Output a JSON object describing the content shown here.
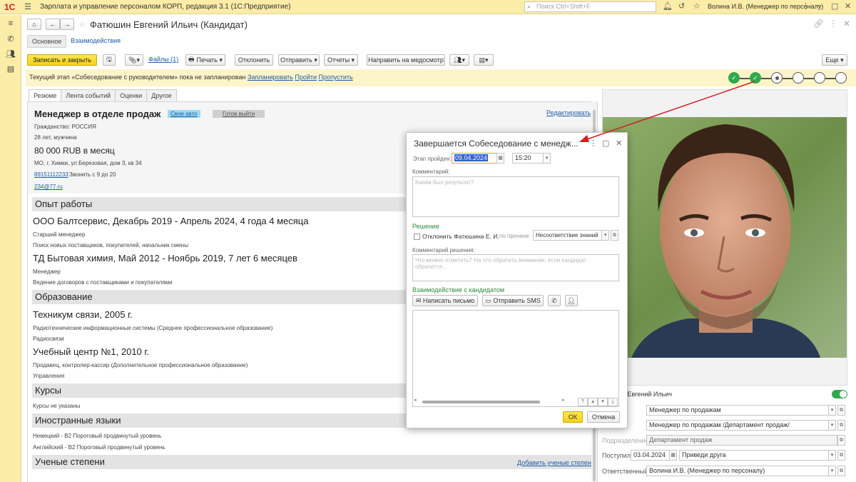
{
  "app": {
    "logo": "1С",
    "title": "Зарплата и управление персоналом КОРП, редакция 3.1  (1С:Предприятие)",
    "search_placeholder": "Поиск Ctrl+Shift+F",
    "user": "Волина И.В. (Менеджер по персоналу)"
  },
  "document": {
    "title": "Фатюшин Евгений Ильич (Кандидат)",
    "tabs": [
      "Основное",
      "Взаимодействия"
    ]
  },
  "toolbar": {
    "save_close": "Записать и закрыть",
    "files": "Файлы (1)",
    "print": "Печать",
    "reject": "Отклонить",
    "send": "Отправить",
    "reports": "Отчеты",
    "medical": "Направить на медосмотр",
    "more": "Еще"
  },
  "stage": {
    "text": "Текущий этап «Собеседование с руководителем» пока не запланирован",
    "plan": "Запланировать",
    "pass": "Пройти",
    "skip": "Пропустить",
    "nodes": [
      "done",
      "done",
      "current",
      "pending",
      "pending",
      "pending"
    ]
  },
  "panel_tabs": [
    "Резюме",
    "Лента событий",
    "Оценки",
    "Другое"
  ],
  "resume": {
    "position": "Менеджер в отделе продаж",
    "badge_car": "Свое авто",
    "badge_ready": "Готов выйти",
    "edit": "Редактировать",
    "citizenship": "Гражданство: РОССИЯ",
    "age": "28 лет, мужчина",
    "salary": "80 000 RUB в месяц",
    "address": "МО, г. Химки, ул Березовая, дом 3, кв 34",
    "phone": "89151112233",
    "phone_note": "Звонить с 9 до 20",
    "email": "234@77.ru",
    "section_work": "Опыт работы",
    "job1_title": "ООО Балтсервис, Декабрь 2019 - Апрель 2024, 4 года 4 месяца",
    "job1_role": "Старший менеджер",
    "job1_desc": "Поиск новых поставщиков, покупателей, начальник смены",
    "job2_title": "ТД Бытовая химия, Май 2012 - Ноябрь 2019, 7 лет 6 месяцев",
    "job2_role": "Менеджер",
    "job2_desc": "Ведение договоров с поставщиками и покупателями",
    "section_edu": "Образование",
    "edu1_title": "Техникум связи, 2005 г.",
    "edu1_desc": "Радиотехнические информационные системы (Среднее профессиональное образование)",
    "edu1_spec": "Радиосвязи",
    "edu2_title": "Учебный центр №1, 2010 г.",
    "edu2_desc": "Продавец, контролер-кассир (Дополнительное профессиональное образование)",
    "edu2_spec": "Управления",
    "section_courses": "Курсы",
    "courses_none": "Курсы не указаны",
    "section_lang": "Иностранные языки",
    "lang1": "Немецкий - B2 Пороговый продвинутый уровень",
    "lang2": "Английский - B2 Пороговый продвинутый уровень",
    "section_degrees": "Ученые степени",
    "add_degree": "Добавить ученые степени"
  },
  "right": {
    "name_value": "н Евгений Ильич",
    "position_value": "Менеджер  по продажам",
    "vacancy_value": "Менеджер по продажам /Департамент продаж/",
    "dept_label": "Подразделение:",
    "dept_value": "Департамент продаж",
    "joined_label": "Поступил:",
    "joined_value": "03.04.2024",
    "source_value": "Приведи друга",
    "resp_label": "Ответственный:",
    "resp_value": "Волина И.В. (Менеджер по персоналу)"
  },
  "dialog": {
    "title": "Завершается Собеседование с менедж...",
    "stage_label": "Этап пройден:",
    "date_value": "09.04.2024",
    "time_value": "15:20",
    "comment_label": "Комментарий:",
    "comment_placeholder": "Каким был результат?",
    "decision_label": "Решение",
    "reject_label": "Отклонить Фатюшина Е. И.",
    "reason_label": "по причине",
    "reason_value": "Несоответствие знаний",
    "decision_comment_label": "Комментарий решения:",
    "decision_comment_placeholder": "Что можно отметить? На что обратить внимание, если кандидат обратится...",
    "interaction_label": "Взаимодействие с кандидатом",
    "write_letter": "Написать письмо",
    "send_sms": "Отправить SMS",
    "ok": "ОК",
    "cancel": "Отмена"
  },
  "colors": {
    "accent_yellow": "#f7d21b",
    "stage_done": "#2fa84f",
    "link": "#1d5ea8",
    "arrow": "#d0201f"
  }
}
